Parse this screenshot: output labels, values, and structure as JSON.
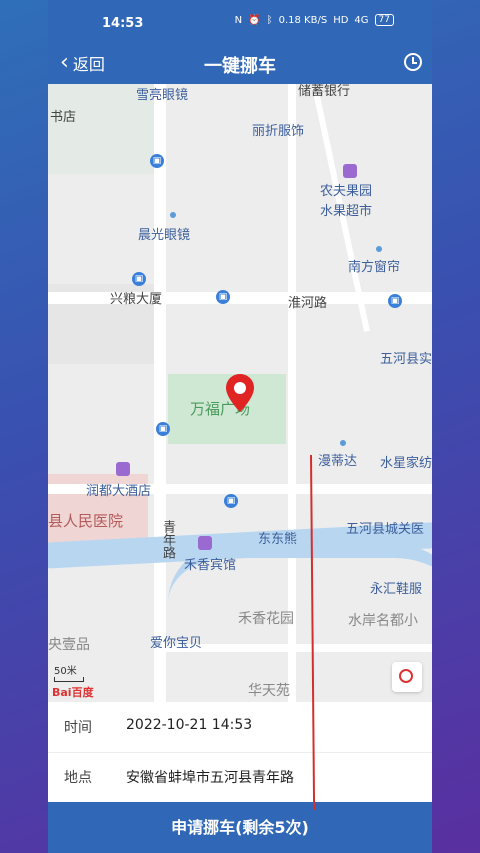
{
  "status_bar": {
    "time": "14:53",
    "net_speed": "0.18 KB/S",
    "network": "HD",
    "signal": "4G",
    "battery": "77"
  },
  "header": {
    "back_label": "返回",
    "title": "一键挪车"
  },
  "map": {
    "labels": {
      "shop_glasses_top": "雪亮眼镜",
      "bank": "储蓄银行",
      "bookstore": "书店",
      "clothing": "丽折服饰",
      "fruit1": "农夫果园",
      "fruit2": "水果超市",
      "glasses": "晨光眼镜",
      "window": "南方窗帘",
      "building": "兴粮大厦",
      "road_huaihe": "淮河路",
      "county": "五河县实",
      "plaza": "万福广场",
      "mandida": "漫蒂达",
      "water_star": "水星家纺",
      "hotel_rundu": "润都大酒店",
      "hospital": "县人民医院",
      "road_qingnian": "青年路",
      "bear": "东东熊",
      "county_primary": "五河县城关医",
      "hotel_hexiang": "禾香宾馆",
      "shoe": "永汇鞋服",
      "garden": "禾香花园",
      "water_bank": "水岸名都小",
      "yanghu": "央壹品",
      "baby": "爱你宝贝",
      "huatian": "华天苑",
      "scale": "50米",
      "brand": "Bai百度"
    }
  },
  "info": {
    "time_label": "时间",
    "time_value": "2022-10-21 14:53",
    "location_label": "地点",
    "location_value": "安徽省蚌埠市五河县青年路"
  },
  "submit_label": "申请挪车(剩余5次)"
}
